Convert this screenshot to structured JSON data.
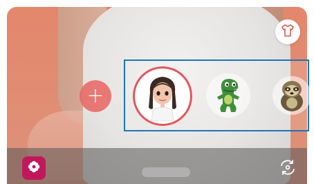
{
  "toolbar": {
    "clothing_icon": "tshirt-icon",
    "add_icon": "plus-icon",
    "add_label": "+",
    "effects_icon": "flower-icon",
    "switch_camera_icon": "rotate-camera-icon"
  },
  "emoji_list": {
    "items": [
      {
        "name": "my-emoji-girl",
        "selected": true
      },
      {
        "name": "dinosaur-emoji",
        "selected": false
      },
      {
        "name": "sloth-emoji",
        "selected": false
      }
    ]
  },
  "colors": {
    "background": "#e4876c",
    "accent_red": "#e3555a",
    "highlight_frame": "#1b75b8",
    "effects_button": "#c2185b",
    "add_button": "#e86a68"
  }
}
